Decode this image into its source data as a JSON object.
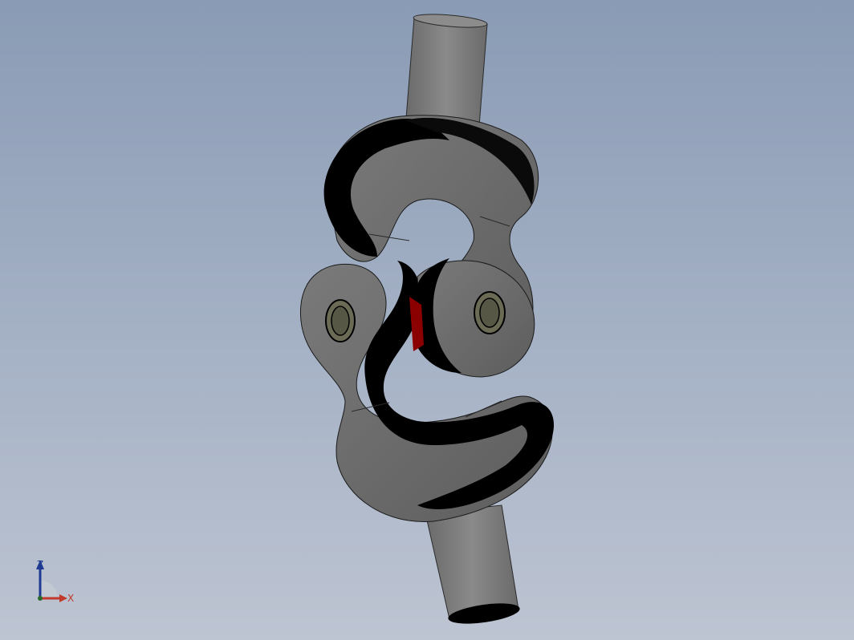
{
  "viewport": {
    "background_top": "#8a9bb5",
    "background_bottom": "#bdc4d2"
  },
  "model": {
    "name": "universal-joint",
    "colors": {
      "shaft": "#7f7f7f",
      "shaft_edge": "#2a2a2a",
      "yoke_face": "#6e6e6e",
      "yoke_dark": "#000000",
      "pin_ring": "#6b6b55",
      "pin_center": "#4a4a3c",
      "contact_highlight": "#8b0000"
    }
  },
  "triad": {
    "z_label": "Z",
    "x_label": "X",
    "z_color": "#1f3a93",
    "x_color": "#c0392b"
  }
}
